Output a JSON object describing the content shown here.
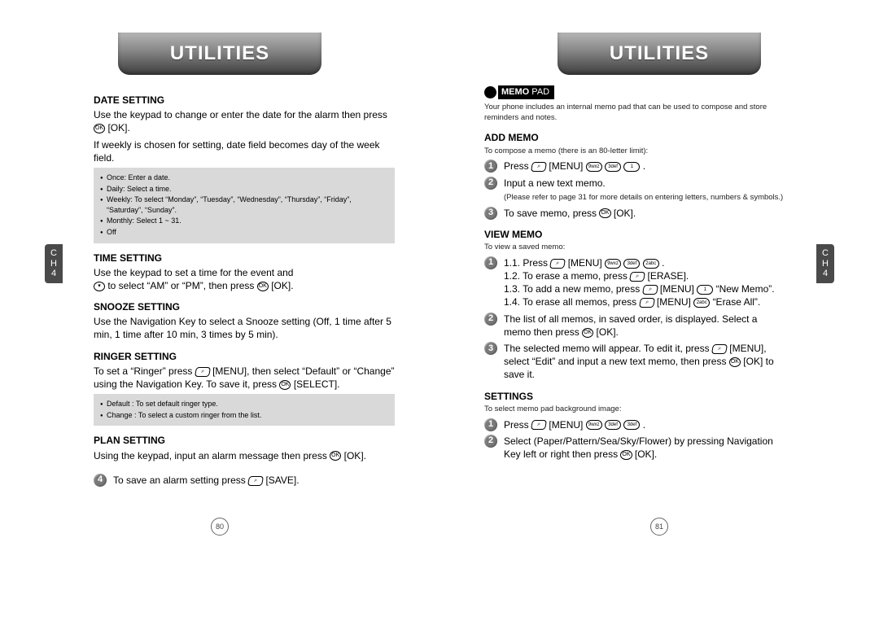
{
  "header": "UTILITIES",
  "chapter": {
    "label": "C\nH",
    "num": "4"
  },
  "left": {
    "dateSetting": {
      "title": "DATE SETTING",
      "body1": "Use the keypad to change or enter the date for the alarm then press",
      "body1b": "[OK].",
      "body2": "If weekly is chosen for setting, date field becomes day of the week field.",
      "notes": [
        "Once: Enter a date.",
        "Daily: Select a time.",
        "Weekly: To select “Monday”, “Tuesday”, “Wednesday”, “Thursday”, “Friday”, “Saturday”, “Sunday”.",
        "Monthly: Select 1 ~ 31.",
        "Off"
      ]
    },
    "timeSetting": {
      "title": "TIME SETTING",
      "body1": "Use the keypad to set a time for the event and",
      "body2a": "to select “AM” or “PM”, then press",
      "body2b": "[OK]."
    },
    "snooze": {
      "title": "SNOOZE SETTING",
      "body": "Use the Navigation Key to select a Snooze setting (Off, 1 time after 5 min, 1 time after 10 min, 3 times by 5 min)."
    },
    "ringer": {
      "title": "RINGER SETTING",
      "body1a": "To set a “Ringer” press",
      "body1b": "[MENU], then select “Default” or “Change” using the Navigation Key. To save it, press",
      "body1c": "[SELECT].",
      "notes": [
        "Default : To set default ringer type.",
        "Change : To select a custom ringer from the list."
      ]
    },
    "plan": {
      "title": "PLAN SETTING",
      "body1": "Using the keypad, input an alarm message then press",
      "body1b": "[OK]."
    },
    "saveStep": {
      "text1": "To save an alarm setting press",
      "text2": "[SAVE]."
    },
    "pagenum": "80"
  },
  "right": {
    "memoBadge": {
      "strong": "MEMO",
      "light": "PAD"
    },
    "intro": "Your phone includes an internal memo pad that can be used to compose and store reminders and notes.",
    "add": {
      "title": "ADD MEMO",
      "sub": "To compose a memo (there is an 80-letter limit):",
      "step1a": "Press",
      "step1b": "[MENU]",
      "step2": "Input a new text memo.",
      "step2note": "(Please refer to page 31 for more details on entering letters, numbers & symbols.)",
      "step3a": "To save memo, press",
      "step3b": "[OK]."
    },
    "view": {
      "title": "VIEW MEMO",
      "sub": "To view a saved memo:",
      "s1_1a": "1.1. Press",
      "s1_1b": "[MENU]",
      "s1_2a": "1.2. To erase a memo, press",
      "s1_2b": "[ERASE].",
      "s1_3a": "1.3. To add a new memo, press",
      "s1_3b": "[MENU]",
      "s1_3c": "“New Memo”.",
      "s1_4a": "1.4. To erase all memos, press",
      "s1_4b": "[MENU]",
      "s1_4c": "“Erase All”.",
      "s2a": "The list of all memos, in saved order, is displayed. Select a memo then press",
      "s2b": "[OK].",
      "s3a": "The selected memo will appear.  To edit it, press",
      "s3b": "[MENU], select “Edit” and input a new text memo, then press",
      "s3c": "[OK] to save it."
    },
    "settings": {
      "title": "SETTINGS",
      "sub": "To select memo pad background image:",
      "s1a": "Press",
      "s1b": "[MENU]",
      "s2a": "Select (Paper/Pattern/Sea/Sky/Flower) by pressing Navigation Key left or right then press",
      "s2b": "[OK]."
    },
    "pagenum": "81"
  },
  "iconLabels": {
    "ok": "OK",
    "menu": "⌕",
    "softkey": "⌕",
    "down": "▾",
    "nine": "9wxz",
    "three": "3def",
    "two": "2abc",
    "one": "1"
  }
}
